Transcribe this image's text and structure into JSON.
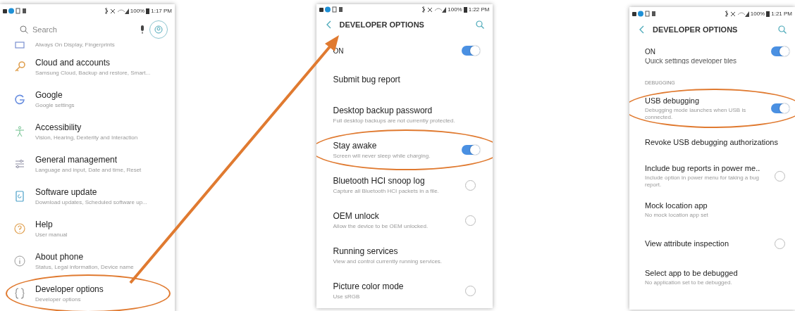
{
  "panels": [
    {
      "status_bar": {
        "battery": "100%",
        "time": "1:17 PM"
      },
      "search": {
        "placeholder": "Search"
      },
      "items": [
        {
          "kind": "row",
          "subtitle": "Always On Display, Fingerprints",
          "highlighted": false
        },
        {
          "kind": "row",
          "title": "Cloud and accounts",
          "subtitle": "Samsung Cloud, Backup and restore, Smart...",
          "highlighted": false
        },
        {
          "kind": "row",
          "title": "Google",
          "subtitle": "Google settings",
          "highlighted": false
        },
        {
          "kind": "row",
          "title": "Accessibility",
          "subtitle": "Vision, Hearing, Dexterity and Interaction",
          "highlighted": false
        },
        {
          "kind": "row",
          "title": "General management",
          "subtitle": "Language and input, Date and time, Reset",
          "highlighted": false
        },
        {
          "kind": "row",
          "title": "Software update",
          "subtitle": "Download updates, Scheduled software up...",
          "highlighted": false
        },
        {
          "kind": "row",
          "title": "Help",
          "subtitle": "User manual",
          "highlighted": false
        },
        {
          "kind": "row",
          "title": "About phone",
          "subtitle": "Status, Legal information, Device name",
          "highlighted": false
        },
        {
          "kind": "row",
          "title": "Developer options",
          "subtitle": "Developer options",
          "highlighted": true
        }
      ]
    },
    {
      "status_bar": {
        "battery": "100%",
        "time": "1:22 PM"
      },
      "header": {
        "title": "DEVELOPER OPTIONS"
      },
      "items": [
        {
          "kind": "master",
          "title": "ON",
          "on": true,
          "highlighted": false
        },
        {
          "kind": "row",
          "title": "Submit bug report",
          "highlighted": false
        },
        {
          "kind": "row",
          "title": "Desktop backup password",
          "subtitle": "Full desktop backups are not currently protected.",
          "highlighted": false
        },
        {
          "kind": "row",
          "title": "Stay awake",
          "subtitle": "Screen will never sleep while charging.",
          "on": true,
          "highlighted": true
        },
        {
          "kind": "row",
          "title": "Bluetooth HCI snoop log",
          "subtitle": "Capture all Bluetooth HCI packets in a file.",
          "on": false,
          "highlighted": false
        },
        {
          "kind": "row",
          "title": "OEM unlock",
          "subtitle": "Allow the device to be OEM unlocked.",
          "on": false,
          "highlighted": false
        },
        {
          "kind": "row",
          "title": "Running services",
          "subtitle": "View and control currently running services.",
          "highlighted": false
        },
        {
          "kind": "row",
          "title": "Picture color mode",
          "subtitle": "Use sRGB",
          "on": false,
          "highlighted": false
        }
      ]
    },
    {
      "status_bar": {
        "battery": "100%",
        "time": "1:21 PM"
      },
      "header": {
        "title": "DEVELOPER OPTIONS"
      },
      "items": [
        {
          "kind": "master",
          "title": "ON",
          "on": true,
          "highlighted": false
        },
        {
          "kind": "partial",
          "title": "Quick settings developer tiles",
          "highlighted": false
        },
        {
          "kind": "header",
          "title": "DEBUGGING",
          "highlighted": false
        },
        {
          "kind": "row",
          "title": "USB debugging",
          "subtitle": "Debugging mode launches when USB is connected.",
          "on": true,
          "highlighted": true
        },
        {
          "kind": "row",
          "title": "Revoke USB debugging authorizations",
          "highlighted": false
        },
        {
          "kind": "row",
          "title": "Include bug reports in power me..",
          "subtitle": "Include option in power menu for taking a bug report.",
          "on": false,
          "highlighted": false
        },
        {
          "kind": "row",
          "title": "Mock location app",
          "subtitle": "No mock location app set",
          "highlighted": false
        },
        {
          "kind": "row",
          "title": "View attribute inspection",
          "on": false,
          "highlighted": false
        },
        {
          "kind": "row",
          "title": "Select app to be debugged",
          "subtitle": "No application set to be debugged.",
          "highlighted": false
        }
      ]
    }
  ]
}
